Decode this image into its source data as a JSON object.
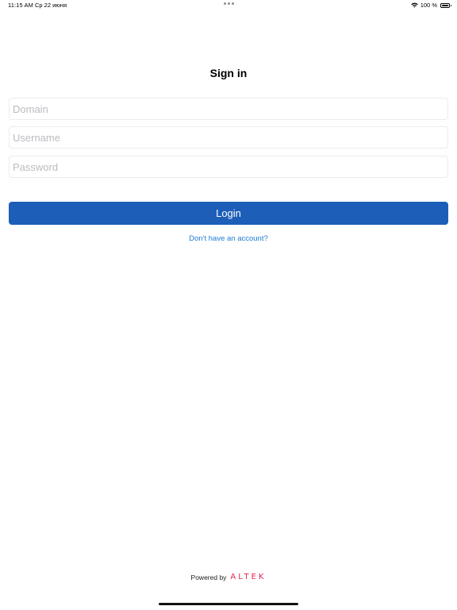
{
  "status_bar": {
    "time": "11:15 AM",
    "date": "Ср 22 июня",
    "battery_text": "100 %",
    "icons": [
      "wifi-icon",
      "battery-icon"
    ]
  },
  "form": {
    "title": "Sign in",
    "domain_placeholder": "Domain",
    "domain_value": "",
    "username_placeholder": "Username",
    "username_value": "",
    "password_placeholder": "Password",
    "password_value": "",
    "login_label": "Login",
    "signup_link": "Don't have an account?"
  },
  "footer": {
    "powered_by": "Powered by",
    "brand": "ALTEK"
  },
  "colors": {
    "primary_button": "#1d5eb9",
    "link": "#1f7ad1",
    "brand": "#e2264d"
  }
}
